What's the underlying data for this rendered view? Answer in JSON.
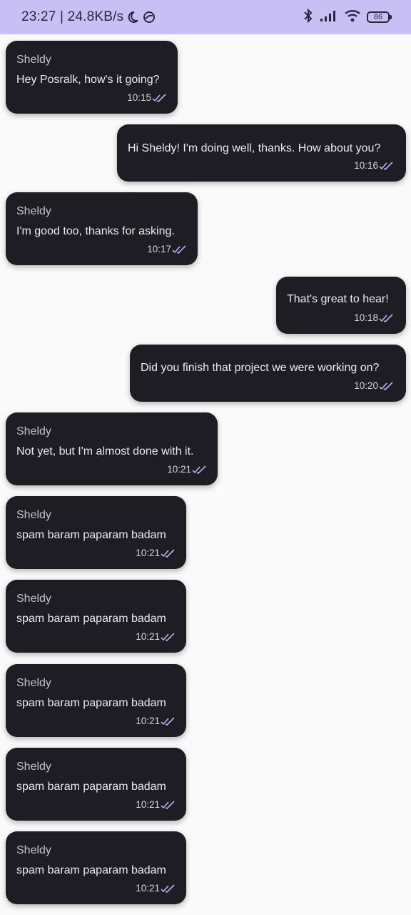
{
  "status": {
    "time_speed": "23:27 | 24.8KB/s",
    "battery": "86"
  },
  "messages": [
    {
      "sender": "Sheldy",
      "text": "Hey Posralk, how's it going?",
      "time": "10:15"
    },
    {
      "text": "Hi Sheldy! I'm doing well, thanks. How about you?",
      "time": "10:16"
    },
    {
      "sender": "Sheldy",
      "text": "I'm good too, thanks for asking.",
      "time": "10:17"
    },
    {
      "text": "That's great to hear!",
      "time": "10:18"
    },
    {
      "text": "Did you finish that project we were working on?",
      "time": "10:20"
    },
    {
      "sender": "Sheldy",
      "text": "Not yet, but I'm almost done with it.",
      "time": "10:21"
    },
    {
      "sender": "Sheldy",
      "text": "spam baram paparam badam",
      "time": "10:21"
    },
    {
      "sender": "Sheldy",
      "text": "spam baram paparam badam",
      "time": "10:21"
    },
    {
      "sender": "Sheldy",
      "text": "spam baram paparam badam",
      "time": "10:21"
    },
    {
      "sender": "Sheldy",
      "text": "spam baram paparam badam",
      "time": "10:21"
    },
    {
      "sender": "Sheldy",
      "text": "spam baram paparam badam",
      "time": "10:21"
    }
  ],
  "colors": {
    "status_bar": "#c8c0f5",
    "background": "#fafafa",
    "bubble": "#1e1d23",
    "read_ticks": "#b9b0f0"
  },
  "icons": [
    "moon-icon",
    "sync-icon",
    "bluetooth-icon",
    "cellular-signal-icon",
    "wifi-icon",
    "battery-icon",
    "double-check-icon"
  ]
}
